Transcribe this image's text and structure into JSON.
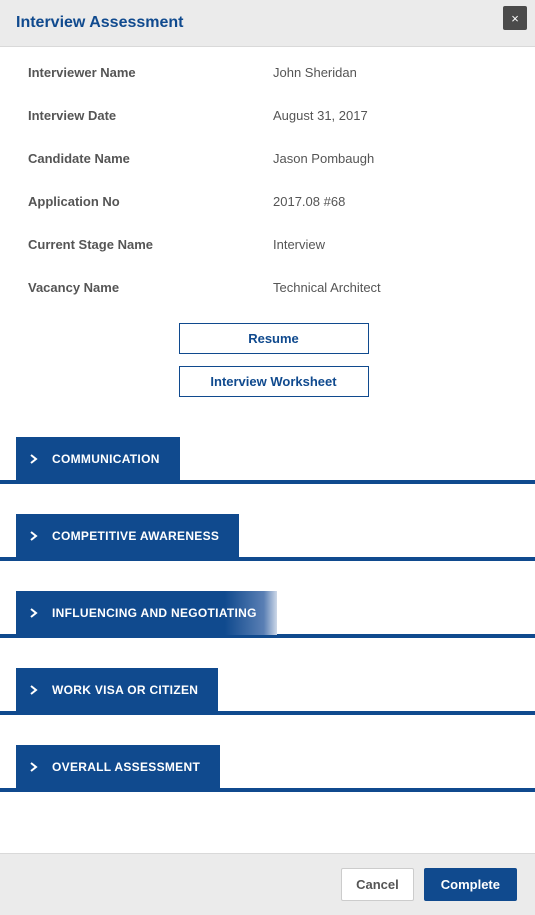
{
  "header": {
    "title": "Interview Assessment",
    "close_label": "×"
  },
  "fields": {
    "interviewer_name": {
      "label": "Interviewer Name",
      "value": "John Sheridan"
    },
    "interview_date": {
      "label": "Interview Date",
      "value": "August 31, 2017"
    },
    "candidate_name": {
      "label": "Candidate Name",
      "value": "Jason Pombaugh"
    },
    "application_no": {
      "label": "Application No",
      "value": "2017.08 #68"
    },
    "current_stage": {
      "label": "Current Stage Name",
      "value": "Interview"
    },
    "vacancy_name": {
      "label": "Vacancy Name",
      "value": "Technical Architect"
    }
  },
  "buttons": {
    "resume": "Resume",
    "worksheet": "Interview Worksheet"
  },
  "sections": [
    {
      "label": "COMMUNICATION",
      "fade": false
    },
    {
      "label": "COMPETITIVE AWARENESS",
      "fade": false
    },
    {
      "label": "INFLUENCING AND NEGOTIATING",
      "fade": true
    },
    {
      "label": "WORK VISA OR CITIZEN",
      "fade": false
    },
    {
      "label": "OVERALL ASSESSMENT",
      "fade": false
    }
  ],
  "footer": {
    "cancel": "Cancel",
    "complete": "Complete"
  }
}
